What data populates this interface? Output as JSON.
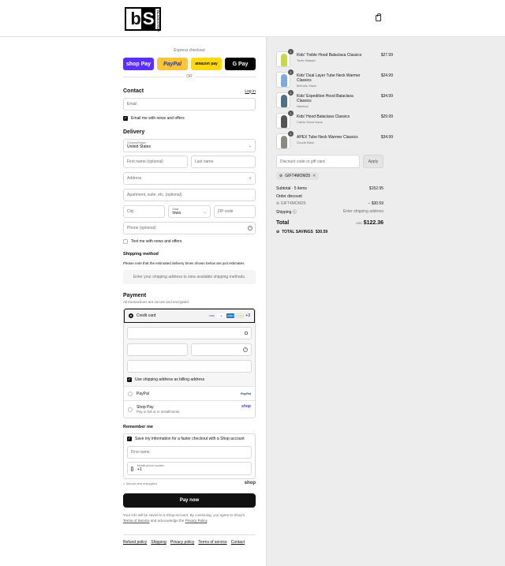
{
  "header": {
    "logo_main": "bS",
    "logo_sub": "BLACKSTRAP"
  },
  "express": {
    "label": "Express checkout",
    "buttons": [
      "shop Pay",
      "PayPal",
      "amazon pay",
      "G Pay"
    ],
    "or": "OR"
  },
  "contact": {
    "title": "Contact",
    "login": "Log in",
    "email_placeholder": "Email",
    "news_label": "Email me with news and offers"
  },
  "delivery": {
    "title": "Delivery",
    "country_label": "Country/Region",
    "country": "United States",
    "first_name": "First name (optional)",
    "last_name": "Last name",
    "address": "Address",
    "apartment": "Apartment, suite, etc. (optional)",
    "city": "City",
    "state_label": "State",
    "state": "Iowa",
    "zip": "ZIP code",
    "phone": "Phone (optional)",
    "text_label": "Text me with news and offers"
  },
  "shipping": {
    "title": "Shipping method",
    "note": "Please note that the estimated delivery times shown below are just estimates.",
    "placeholder": "Enter your shipping address to view available shipping methods."
  },
  "payment": {
    "title": "Payment",
    "subtitle": "All transactions are secure and encrypted.",
    "credit_card": "Credit card",
    "more": "+3",
    "cards": [
      "VISA",
      "MC",
      "AMEX",
      "DISC"
    ],
    "billing_label": "Use shipping address as billing address",
    "paypal": "PayPal",
    "paypal_logo": "PayPal",
    "shoppay": "Shop Pay",
    "shoppay_sub": "Pay in full or in installments",
    "shoppay_logo": "shop"
  },
  "remember": {
    "title": "Remember me",
    "save_label": "Save my information for a faster checkout with a Shop account",
    "first_name": "First name",
    "phone_label": "Mobile phone number",
    "phone_value": "+1",
    "secure": "Secure and encrypted",
    "shop_logo": "shop"
  },
  "paynow": "Pay now",
  "legal": {
    "text": "Your info will be saved to a Shop account. By continuing, you agree to Shop's",
    "tos": "Terms of Service",
    "mid": "and acknowledge the",
    "privacy": "Privacy Policy",
    "end": "."
  },
  "footer_links": [
    "Refund policy",
    "Shipping",
    "Privacy policy",
    "Terms of service",
    "Contact"
  ],
  "cart": {
    "items": [
      {
        "qty": "1",
        "name": "Kids' Treble Hood Balaclava Classics",
        "variant": "Toxin Wasabi",
        "price": "$27.99",
        "color": "#c7d84a"
      },
      {
        "qty": "1",
        "name": "Kids' Dual Layer Tube Neck Warmer Classics",
        "variant": "Melodic Glaze",
        "price": "$24.99",
        "color": "#7fa9d8"
      },
      {
        "qty": "1",
        "name": "Kids' Expedition Hood Balaclava Classics",
        "variant": "Nautical",
        "price": "$34.99",
        "color": "#4f7282"
      },
      {
        "qty": "1",
        "name": "Kids' Hood Balaclava Classics",
        "variant": "Calvin Snow Issue",
        "price": "$29.99",
        "color": "#555555"
      },
      {
        "qty": "1",
        "name": "APEX Tube Neck Warmer Classics",
        "variant": "Goode Back",
        "price": "$34.99",
        "color": "#8a8a80"
      }
    ],
    "discount_placeholder": "Discount code or gift card",
    "apply": "Apply",
    "code_tag": "GIFT4MOM25",
    "subtotal_label": "Subtotal · 5 items",
    "subtotal": "$152.95",
    "order_discount_label": "Order discount",
    "code_label": "GIFT4MOM25",
    "discount": "− $30.59",
    "shipping_label": "Shipping",
    "shipping_value": "Enter shipping address",
    "total_label": "Total",
    "currency": "USD",
    "total": "$122.36",
    "savings_label": "TOTAL SAVINGS",
    "savings": "$30.59"
  }
}
